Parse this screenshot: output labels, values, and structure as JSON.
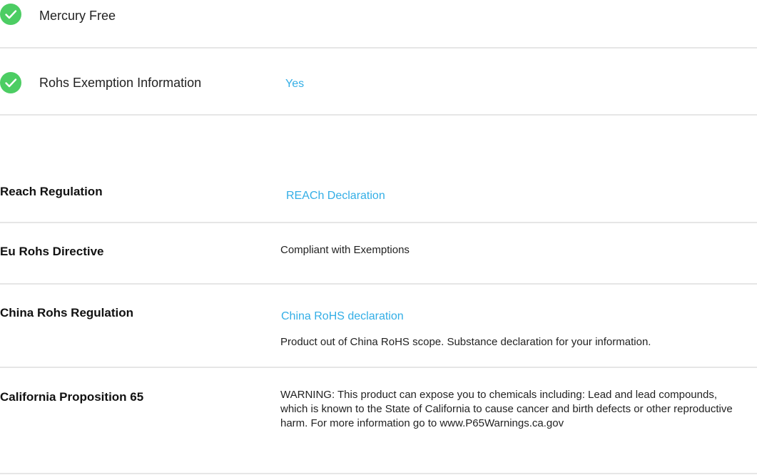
{
  "environmental": {
    "items": [
      {
        "label": "Mercury Free",
        "value": ""
      },
      {
        "label": "Rohs Exemption Information",
        "value": "Yes"
      }
    ]
  },
  "compliance": {
    "reach": {
      "label": "Reach Regulation",
      "link": "REACh Declaration"
    },
    "eu_rohs": {
      "label": "Eu Rohs Directive",
      "value": "Compliant with Exemptions"
    },
    "china_rohs": {
      "label": "China Rohs Regulation",
      "link": "China RoHS declaration",
      "note": "Product out of China RoHS scope. Substance declaration for your information."
    },
    "prop65": {
      "label": "California Proposition 65",
      "warning": "WARNING: This product can expose you to chemicals including: Lead and lead compounds, which is known to the State of California to cause cancer and birth defects or other reproductive harm. For more information go to www.P65Warnings.ca.gov"
    }
  },
  "colors": {
    "check": "#4ccd63",
    "link": "#33aee6",
    "divider": "#e6e6e6"
  }
}
